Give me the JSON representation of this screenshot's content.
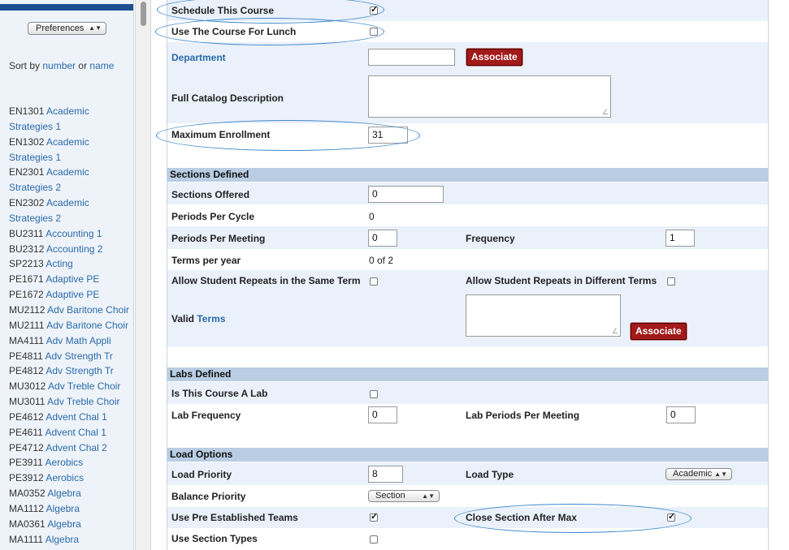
{
  "sidebar": {
    "preferences_label": "Preferences",
    "sort_prefix": "Sort by",
    "sort_number": "number",
    "sort_or": "or",
    "sort_name": "name",
    "courses": [
      {
        "code": "EN1301",
        "name": "Academic"
      },
      {
        "code": "",
        "name": "Strategies 1"
      },
      {
        "code": "EN1302",
        "name": "Academic"
      },
      {
        "code": "",
        "name": "Strategies 1"
      },
      {
        "code": "EN2301",
        "name": "Academic"
      },
      {
        "code": "",
        "name": "Strategies 2"
      },
      {
        "code": "EN2302",
        "name": "Academic"
      },
      {
        "code": "",
        "name": "Strategies 2"
      },
      {
        "code": "BU2311",
        "name": "Accounting 1"
      },
      {
        "code": "BU2312",
        "name": "Accounting 2"
      },
      {
        "code": "SP2213",
        "name": "Acting"
      },
      {
        "code": "PE1671",
        "name": "Adaptive PE"
      },
      {
        "code": "PE1672",
        "name": "Adaptive PE"
      },
      {
        "code": "MU2112",
        "name": "Adv Baritone Choir"
      },
      {
        "code": "MU2111",
        "name": "Adv Baritone Choir"
      },
      {
        "code": "MA4111",
        "name": "Adv Math Appli"
      },
      {
        "code": "PE4811",
        "name": "Adv Strength Tr"
      },
      {
        "code": "PE4812",
        "name": "Adv Strength Tr"
      },
      {
        "code": "MU3012",
        "name": "Adv Treble Choir"
      },
      {
        "code": "MU3011",
        "name": "Adv Treble Choir"
      },
      {
        "code": "PE4612",
        "name": "Advent Chal 1"
      },
      {
        "code": "PE4611",
        "name": "Advent Chal 1"
      },
      {
        "code": "PE4712",
        "name": "Advent Chal 2"
      },
      {
        "code": "PE3911",
        "name": "Aerobics"
      },
      {
        "code": "PE3912",
        "name": "Aerobics"
      },
      {
        "code": "MA0352",
        "name": "Algebra"
      },
      {
        "code": "MA1112",
        "name": "Algebra"
      },
      {
        "code": "MA0361",
        "name": "Algebra"
      },
      {
        "code": "MA1111",
        "name": "Algebra"
      }
    ]
  },
  "form": {
    "schedule_course_label": "Schedule This Course",
    "schedule_course_checked": true,
    "lunch_label": "Use The Course For Lunch",
    "lunch_checked": false,
    "department_label": "Department",
    "department_value": "",
    "associate_label": "Associate",
    "catalog_label": "Full Catalog Description",
    "max_enroll_label": "Maximum Enrollment",
    "max_enroll_value": "31",
    "sections_header": "Sections Defined",
    "sections_offered_label": "Sections Offered",
    "sections_offered_value": "0",
    "periods_cycle_label": "Periods Per Cycle",
    "periods_cycle_value": "0",
    "periods_meeting_label": "Periods Per Meeting",
    "periods_meeting_value": "0",
    "frequency_label": "Frequency",
    "frequency_value": "1",
    "terms_year_label": "Terms per year",
    "terms_year_value": "0 of 2",
    "repeats_same_label": "Allow Student Repeats in the Same Term",
    "repeats_same_checked": false,
    "repeats_diff_label": "Allow Student Repeats in Different Terms",
    "repeats_diff_checked": false,
    "valid_label": "Valid",
    "terms_link": "Terms",
    "labs_header": "Labs Defined",
    "is_lab_label": "Is This Course A Lab",
    "is_lab_checked": false,
    "lab_freq_label": "Lab Frequency",
    "lab_freq_value": "0",
    "lab_periods_label": "Lab Periods Per Meeting",
    "lab_periods_value": "0",
    "load_header": "Load Options",
    "load_priority_label": "Load Priority",
    "load_priority_value": "8",
    "load_type_label": "Load Type",
    "load_type_value": "Academic",
    "balance_label": "Balance Priority",
    "balance_value": "Section",
    "teams_label": "Use Pre Established Teams",
    "teams_checked": true,
    "close_after_max_label": "Close Section After Max",
    "close_after_max_checked": true,
    "section_types_label": "Use Section Types",
    "section_types_checked": false
  },
  "colors": {
    "header_band": "#1d4f8f",
    "link": "#2a6aa8",
    "section_header": "#b9cde3",
    "row_shade": "#eaf1fb",
    "associate_button": "#a31a1a",
    "highlight_oval": "#3b86c9"
  }
}
